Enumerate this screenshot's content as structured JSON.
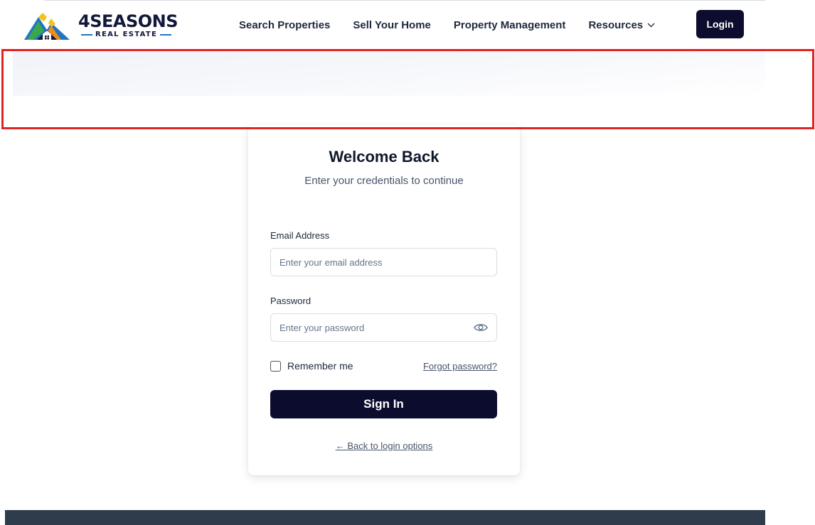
{
  "brand": {
    "name_number": "4",
    "name_word": "SEASONS",
    "tagline": "REAL ESTATE"
  },
  "nav": {
    "items": [
      {
        "label": "Search Properties"
      },
      {
        "label": "Sell Your Home"
      },
      {
        "label": "Property Management"
      },
      {
        "label": "Resources"
      }
    ],
    "login_label": "Login"
  },
  "card": {
    "title": "Welcome Back",
    "subtitle": "Enter your credentials to continue",
    "email": {
      "label": "Email Address",
      "placeholder": "Enter your email address"
    },
    "password": {
      "label": "Password",
      "placeholder": "Enter your password"
    },
    "remember_label": "Remember me",
    "forgot_label": "Forgot password?",
    "submit_label": "Sign In",
    "back_label": "← Back to login options"
  },
  "colors": {
    "primary": "#0c0d2e",
    "highlight": "#e02424",
    "footer": "#2e3c4c",
    "logo_blue": "#1f75c4",
    "logo_green": "#3aa84a",
    "logo_orange": "#f08a1c",
    "logo_yellow": "#f6c31a"
  },
  "icons": [
    "logo-mountains-icon",
    "chevron-down-icon",
    "eye-icon"
  ]
}
